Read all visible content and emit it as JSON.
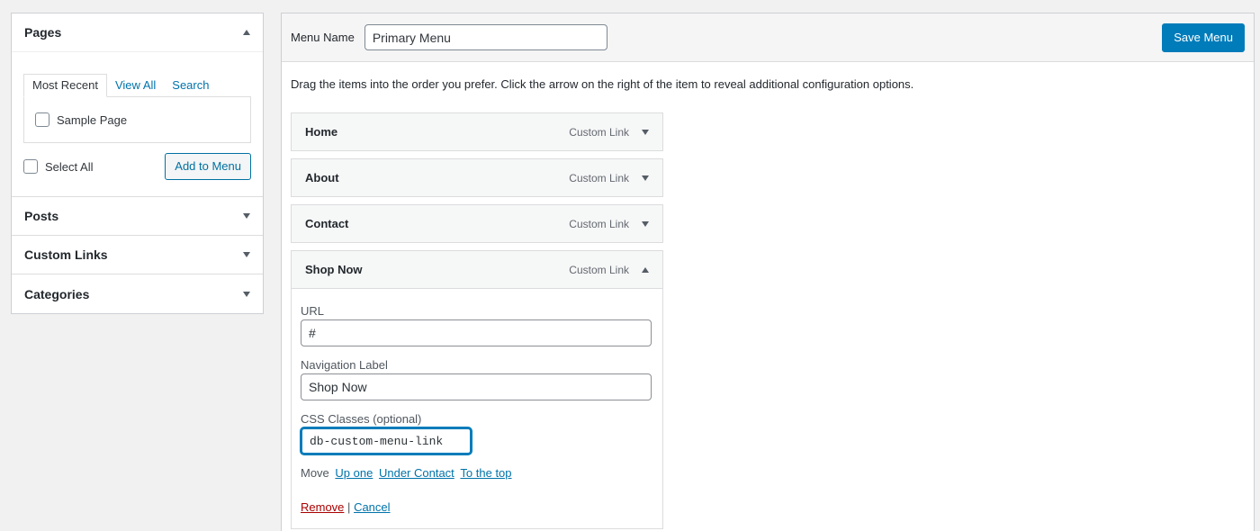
{
  "left_panel": {
    "pages": {
      "title": "Pages",
      "tabs": [
        "Most Recent",
        "View All",
        "Search"
      ],
      "items": [
        "Sample Page"
      ],
      "select_all": "Select All",
      "add_button": "Add to Menu"
    },
    "sections": [
      "Posts",
      "Custom Links",
      "Categories"
    ]
  },
  "menu": {
    "name_label": "Menu Name",
    "name_value": "Primary Menu",
    "save_label": "Save Menu",
    "instructions": "Drag the items into the order you prefer. Click the arrow on the right of the item to reveal additional configuration options.",
    "items": [
      {
        "title": "Home",
        "type": "Custom Link"
      },
      {
        "title": "About",
        "type": "Custom Link"
      },
      {
        "title": "Contact",
        "type": "Custom Link"
      },
      {
        "title": "Shop Now",
        "type": "Custom Link"
      }
    ],
    "expanded": {
      "url_label": "URL",
      "url_value": "#",
      "nav_label": "Navigation Label",
      "nav_value": "Shop Now",
      "css_label": "CSS Classes (optional)",
      "css_value": "db-custom-menu-link",
      "move_label": "Move",
      "move_links": [
        "Up one",
        "Under Contact",
        "To the top"
      ],
      "remove_label": "Remove",
      "separator": "|",
      "cancel_label": "Cancel"
    }
  }
}
